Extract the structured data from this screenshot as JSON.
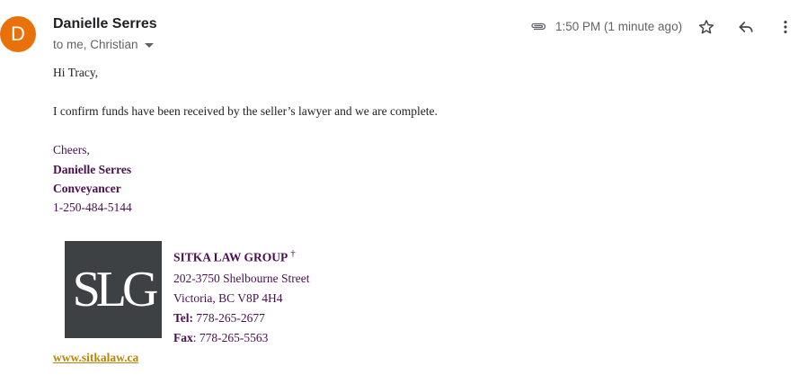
{
  "header": {
    "avatar_initial": "D",
    "avatar_color": "#e8710a",
    "sender_name": "Danielle Serres",
    "recipients": "to me, Christian",
    "time": "1:50 PM (1 minute ago)",
    "icons": [
      "paperclip-icon",
      "star-icon",
      "reply-icon",
      "more-vert-icon"
    ]
  },
  "message": {
    "greeting": "Hi Tracy,",
    "body": "I confirm funds have been received by the seller’s lawyer and we are complete."
  },
  "signature": {
    "closing": "Cheers,",
    "name": "Danielle Serres",
    "title": "Conveyancer",
    "phone": "1-250-484-5144",
    "logo_text": "SLG",
    "firm_name": "SITKA LAW GROUP",
    "firm_mark": "†",
    "address_line1": "202-3750 Shelbourne Street",
    "address_line2": "Victoria, BC V8P 4H4",
    "tel_label": "Tel:",
    "tel_value": " 778-265-2677",
    "fax_label": "Fax",
    "fax_value": ": 778-265-5563",
    "website": "www.sitkalaw.ca",
    "accent_color": "#4a0f4f",
    "link_color": "#b8860b"
  }
}
